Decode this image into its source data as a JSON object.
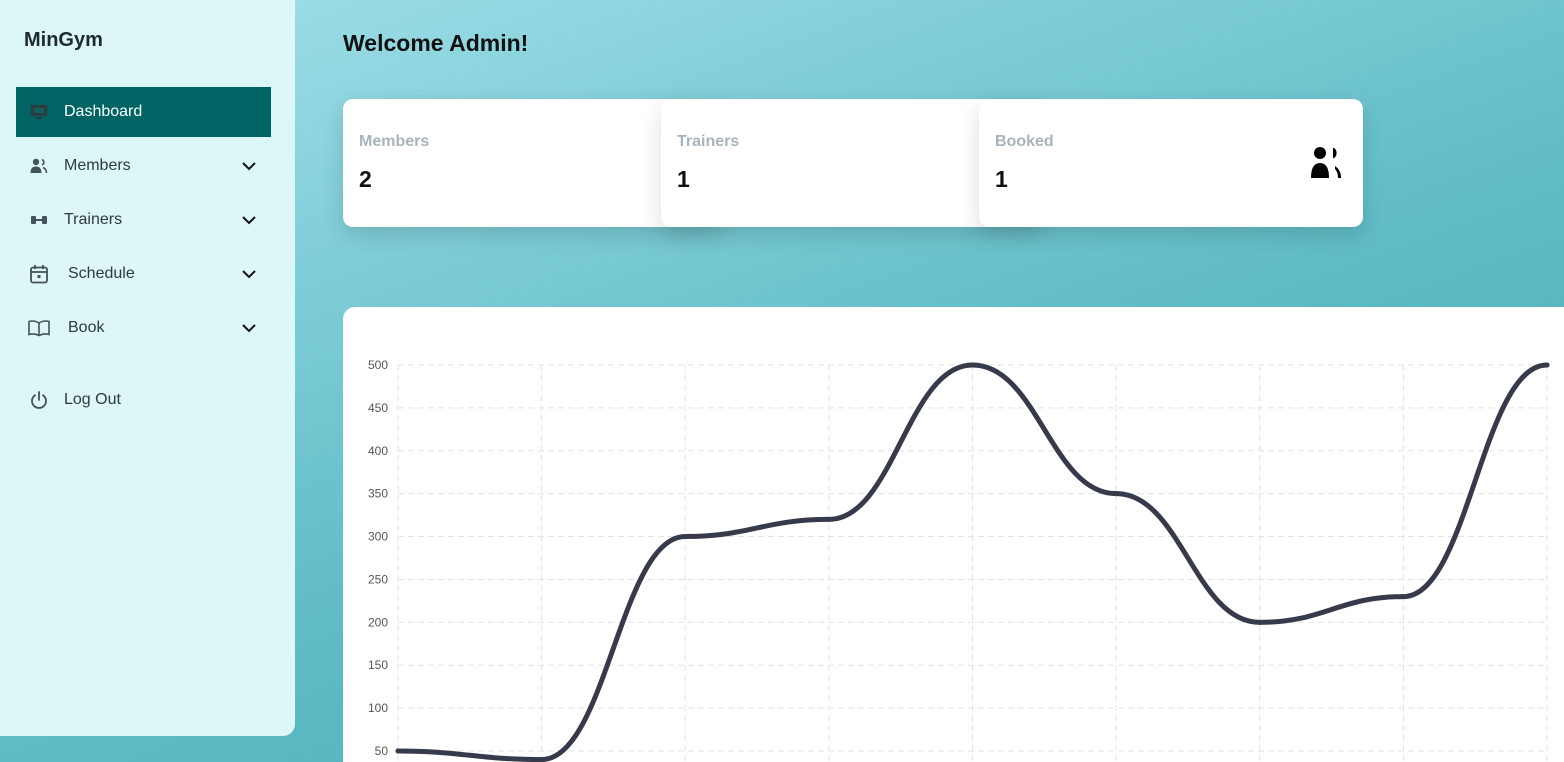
{
  "app": {
    "brand": "MinGym"
  },
  "sidebar": {
    "items": [
      {
        "label": "Dashboard",
        "icon": "dashboard-icon",
        "active": true
      },
      {
        "label": "Members",
        "icon": "members-icon"
      },
      {
        "label": "Trainers",
        "icon": "dumbbell-icon"
      },
      {
        "label": "Schedule",
        "icon": "calendar-icon"
      },
      {
        "label": "Book",
        "icon": "book-icon"
      }
    ],
    "logout": {
      "label": "Log Out",
      "icon": "power-icon"
    }
  },
  "main": {
    "welcome": "Welcome Admin!",
    "stats": [
      {
        "label": "Members",
        "value": "2"
      },
      {
        "label": "Trainers",
        "value": "1"
      },
      {
        "label": "Booked",
        "value": "1",
        "icon": "users-icon"
      }
    ]
  },
  "colors": {
    "sidebar_bg": "#ddf6f8",
    "active_bg": "#006465",
    "line": "#363a4a",
    "label_gray": "#a7b4be"
  },
  "chart_data": {
    "type": "line",
    "ylim": [
      0,
      500
    ],
    "y_ticks": [
      50,
      100,
      150,
      200,
      250,
      300,
      350,
      400,
      450,
      500
    ],
    "grid": true,
    "smooth": true,
    "series": [
      {
        "values": [
          50,
          40,
          300,
          320,
          500,
          350,
          200,
          230,
          500
        ]
      }
    ]
  }
}
